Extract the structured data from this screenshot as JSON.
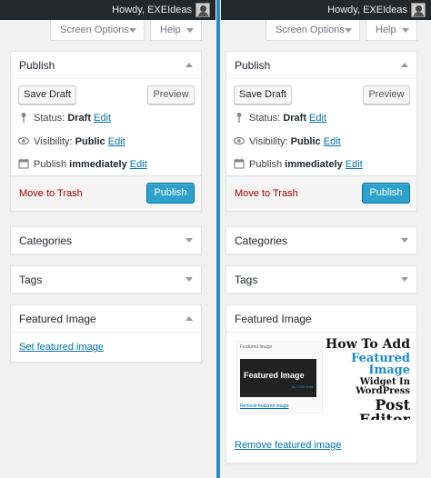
{
  "adminbar": {
    "howdy": "Howdy, EXEIdeas"
  },
  "tabs": {
    "screen_options": "Screen Options",
    "help": "Help"
  },
  "publish": {
    "title": "Publish",
    "save_draft": "Save Draft",
    "preview": "Preview",
    "status_label": "Status:",
    "status_value": "Draft",
    "visibility_label": "Visibility:",
    "visibility_value": "Public",
    "publish_label": "Publish",
    "publish_value": "immediately",
    "edit": "Edit",
    "move_to_trash": "Move to Trash",
    "publish_button": "Publish"
  },
  "categories": {
    "title": "Categories"
  },
  "tags": {
    "title": "Tags"
  },
  "featured": {
    "title": "Featured Image",
    "set_link": "Set featured image",
    "remove_link": "Remove featured image",
    "thumb": {
      "mini_title": "Featured Image",
      "mini_img_text": "Featured Image",
      "mini_img_sub": "by EXEIdeas",
      "mini_remove": "Remove featured image",
      "line1": "How To Add",
      "line2": "Featured Image",
      "line3": "Widget In WordPress",
      "line4": "Post Editor"
    }
  },
  "colors": {
    "divider": "#2a8ccb",
    "publish_button": "#2ea2cc",
    "trash": "#aa0000",
    "link": "#0073aa"
  }
}
